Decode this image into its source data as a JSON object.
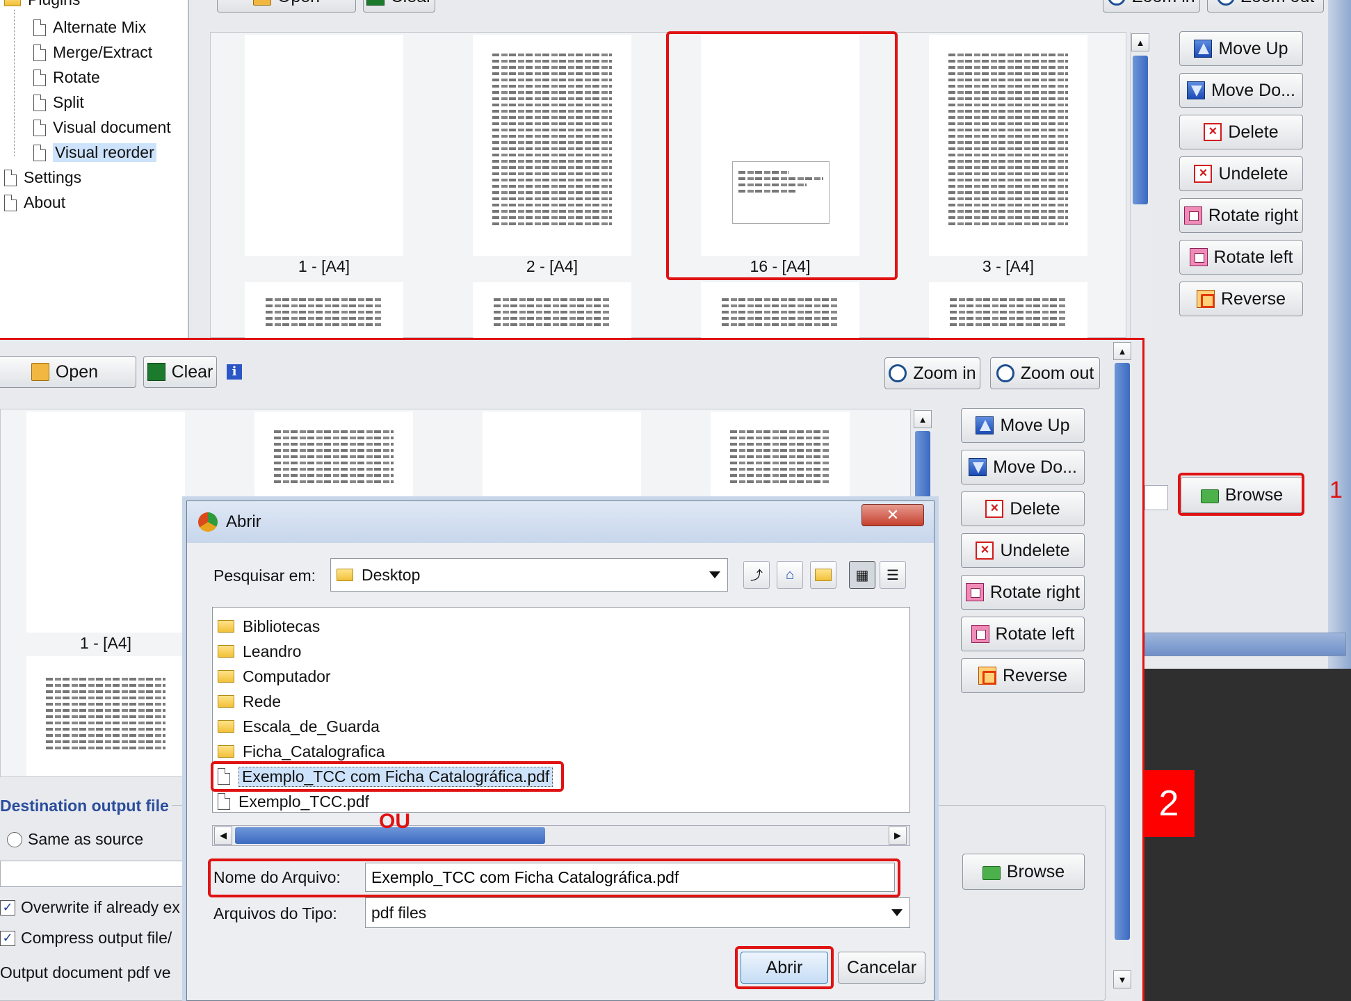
{
  "tree": {
    "plugins_label": "Plugins",
    "items": [
      "Alternate Mix",
      "Merge/Extract",
      "Rotate",
      "Split",
      "Visual document",
      "Visual reorder"
    ],
    "settings_label": "Settings",
    "about_label": "About"
  },
  "back_window": {
    "toolbar": {
      "open": "Open",
      "clear": "Clear",
      "zoom_in": "Zoom in",
      "zoom_out": "Zoom out"
    },
    "thumbs": [
      "1 - [A4]",
      "2 - [A4]",
      "16 - [A4]",
      "3 - [A4]"
    ],
    "side_buttons": [
      "Move Up",
      "Move Do...",
      "Delete",
      "Undelete",
      "Rotate right",
      "Rotate left",
      "Reverse"
    ],
    "browse": "Browse",
    "callout_1": "1"
  },
  "front_window": {
    "toolbar": {
      "open": "Open",
      "clear": "Clear",
      "zoom_in": "Zoom in",
      "zoom_out": "Zoom out"
    },
    "thumb_label": "1 - [A4]",
    "side_buttons": [
      "Move Up",
      "Move Do...",
      "Delete",
      "Undelete",
      "Rotate right",
      "Rotate left",
      "Reverse"
    ],
    "destination_legend": "Destination output file",
    "same_as_source": "Same as source",
    "overwrite": "Overwrite if already ex",
    "compress": "Compress output file/",
    "pdf_version": "Output document pdf ve",
    "browse": "Browse"
  },
  "dialog": {
    "title": "Abrir",
    "look_in_label": "Pesquisar em:",
    "look_in_value": "Desktop",
    "files": [
      {
        "name": "Bibliotecas",
        "type": "folder"
      },
      {
        "name": "Leandro",
        "type": "folder"
      },
      {
        "name": "Computador",
        "type": "folder"
      },
      {
        "name": "Rede",
        "type": "folder"
      },
      {
        "name": "Escala_de_Guarda",
        "type": "folder"
      },
      {
        "name": "Ficha_Catalografica",
        "type": "folder"
      },
      {
        "name": "Exemplo_TCC com Ficha Catalográfica.pdf",
        "type": "file"
      },
      {
        "name": "Exemplo_TCC.pdf",
        "type": "file"
      }
    ],
    "selected_file": "Exemplo_TCC com Ficha Catalográfica.pdf",
    "ou_annotation": "OU",
    "filename_label": "Nome do Arquivo:",
    "filename_value": "Exemplo_TCC com Ficha Catalográfica.pdf",
    "filetype_label": "Arquivos do Tipo:",
    "filetype_value": "pdf files",
    "open_button": "Abrir",
    "cancel_button": "Cancelar"
  },
  "callout_2": "2",
  "colors": {
    "highlight_red": "#e01212",
    "selection_blue": "#cde3fb",
    "callout_bg": "#ff0000"
  }
}
